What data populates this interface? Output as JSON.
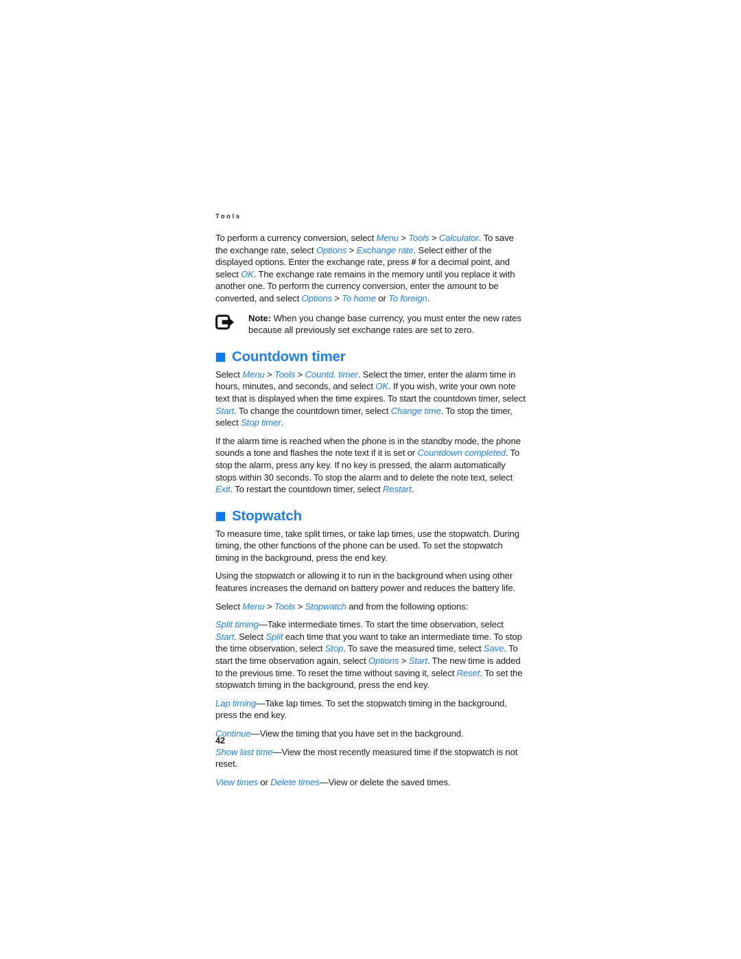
{
  "page": {
    "running_head": "Tools",
    "folio": "42",
    "accent_color": "#1f7ef0",
    "text_color": "#1a1a1a",
    "background": "#ffffff"
  },
  "intro": {
    "p1": {
      "s1": "To perform a currency conversion, select ",
      "ui1": "Menu",
      "gt1": " > ",
      "ui2": "Tools",
      "gt2": " > ",
      "ui3": "Calculator",
      "s2": ". To save the exchange rate, select ",
      "ui4": "Options",
      "gt3": " > ",
      "ui5": "Exchange rate",
      "s3": ". Select either of the displayed options. Enter the exchange rate, press ",
      "hash": "#",
      "s4": " for a decimal point, and select ",
      "ui6": "OK",
      "s5": ". The exchange rate remains in the memory until you replace it with another one. To perform the currency conversion, enter the amount to be converted, and select ",
      "ui7": "Options",
      "gt4": " > ",
      "ui8": "To home",
      "s6": " or ",
      "ui9": "To foreign",
      "s7": "."
    }
  },
  "note": {
    "icon": "note-arrow-icon",
    "label": "Note:",
    "text": " When you change base currency, you must enter the new rates because all previously set exchange rates are set to zero."
  },
  "countdown": {
    "heading": "Countdown timer",
    "p1": {
      "s1": "Select ",
      "ui1": "Menu",
      "gt1": " > ",
      "ui2": "Tools",
      "gt2": " > ",
      "ui3": "Countd. timer",
      "s2": ". Select the timer, enter the alarm time in hours, minutes, and seconds, and select ",
      "ui4": "OK",
      "s3": ". If you wish, write your own note text that is displayed when the time expires. To start the countdown timer, select ",
      "ui5": "Start",
      "s4": ". To change the countdown timer, select ",
      "ui6": "Change time",
      "s5": ". To stop the timer, select ",
      "ui7": "Stop timer",
      "s6": "."
    },
    "p2": {
      "s1": "If the alarm time is reached when the phone is in the standby mode, the phone sounds a tone and flashes the note text if it is set or ",
      "ui1": "Countdown completed",
      "s2": ". To stop the alarm, press any key. If no key is pressed, the alarm automatically stops within 30 seconds. To stop the alarm and to delete the note text, select ",
      "ui2": "Exit",
      "s3": ". To restart the countdown timer, select ",
      "ui3": "Restart",
      "s4": "."
    }
  },
  "stopwatch": {
    "heading": "Stopwatch",
    "p1": "To measure time, take split times, or take lap times, use the stopwatch. During timing, the other functions of the phone can be used. To set the stopwatch timing in the background, press the end key.",
    "p2": "Using the stopwatch or allowing it to run in the background when using other features increases the demand on battery power and reduces the battery life.",
    "p3": {
      "s1": "Select ",
      "ui1": "Menu",
      "gt1": " > ",
      "ui2": "Tools",
      "gt2": " > ",
      "ui3": "Stopwatch",
      "s2": " and from the following options:"
    },
    "options": {
      "split": {
        "ui1": "Split timing",
        "s1": "—Take intermediate times. To start the time observation, select ",
        "ui2": "Start",
        "s2": ". Select ",
        "ui3": "Split",
        "s3": " each time that you want to take an intermediate time. To stop the time observation, select ",
        "ui4": "Stop",
        "s4": ". To save the measured time, select ",
        "ui5": "Save",
        "s5": ". To start the time observation again, select ",
        "ui6": "Options",
        "gt1": " > ",
        "ui7": "Start",
        "s6": ". The new time is added to the previous time. To reset the time without saving it, select ",
        "ui8": "Reset",
        "s7": ". To set the stopwatch timing in the background, press the end key."
      },
      "lap": {
        "ui1": "Lap timing",
        "s1": "—Take lap times. To set the stopwatch timing in the background, press the end key."
      },
      "continue": {
        "ui1": "Continue",
        "s1": "—View the timing that you have set in the background."
      },
      "show_last": {
        "ui1": "Show last time",
        "s1": "—View the most recently measured time if the stopwatch is not reset."
      },
      "view_delete": {
        "ui1": "View times",
        "s1": " or ",
        "ui2": "Delete times",
        "s2": "—View or delete the saved times."
      }
    }
  }
}
